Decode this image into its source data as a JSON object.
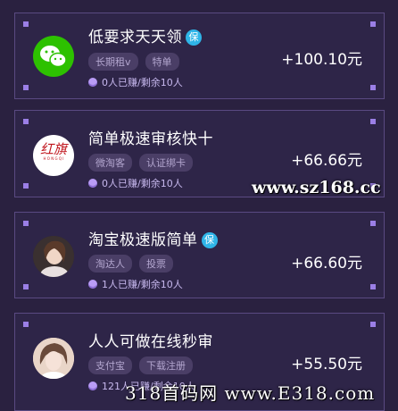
{
  "tasks": [
    {
      "title": "低要求天天领",
      "badge": "保",
      "tags": [
        "长期租v",
        "特单"
      ],
      "stock": "0人已赚/剩余10人",
      "price": "+100.10元",
      "avatar_icon": "wechat-logo",
      "avatar_color": "#2dc100"
    },
    {
      "title": "简单极速审核快十",
      "badge": "",
      "tags": [
        "微淘客",
        "认证绑卡"
      ],
      "stock": "0人已赚/剩余10人",
      "price": "+66.66元",
      "avatar_icon": "hongqi-logo",
      "avatar_logo_text": "红旗",
      "avatar_logo_sub": "H O N G Q I",
      "avatar_color": "#c0141c"
    },
    {
      "title": "淘宝极速版简单",
      "badge": "保",
      "tags": [
        "淘达人",
        "投票"
      ],
      "stock": "1人已赚/剩余10人",
      "price": "+66.60元",
      "avatar_icon": "user-photo",
      "avatar_color": "#e8c8b8"
    },
    {
      "title": "人人可做在线秒审",
      "badge": "",
      "tags": [
        "支付宝",
        "下载注册"
      ],
      "stock": "121人已赚/剩余10人",
      "price": "+55.50元",
      "avatar_icon": "user-photo",
      "avatar_color": "#e9d5c8"
    }
  ],
  "watermarks": {
    "site1": "www.sz168.cc",
    "site2": "318首码网 www.E318.com"
  },
  "colors": {
    "background": "#2a2140",
    "card": "#2e2548",
    "accent": "#9b7fe6",
    "badge": "#2fb5e8"
  }
}
